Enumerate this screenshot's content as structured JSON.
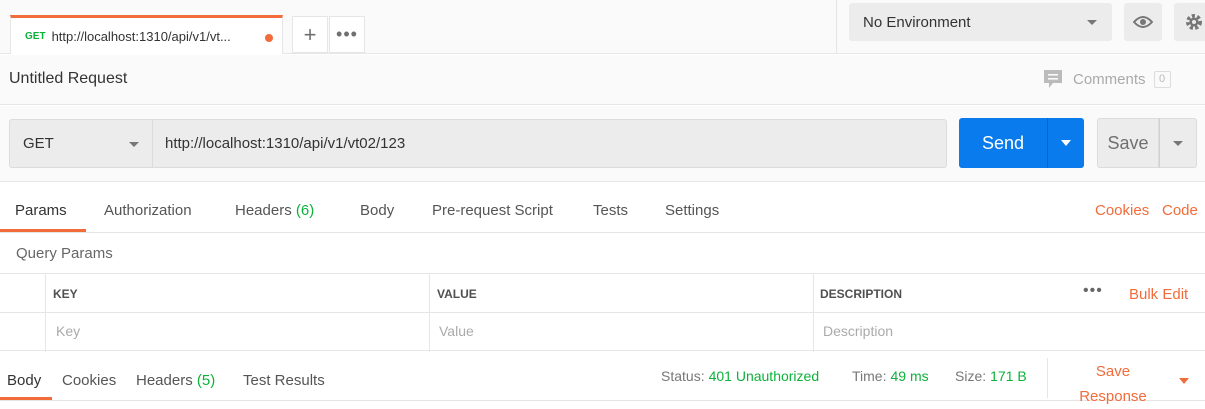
{
  "tabs": [
    {
      "method": "GET",
      "title": "http://localhost:1310/api/v1/vt..."
    }
  ],
  "environment": {
    "selected": "No Environment"
  },
  "request": {
    "title": "Untitled Request",
    "comments_label": "Comments",
    "comments_count": "0",
    "method": "GET",
    "url": "http://localhost:1310/api/v1/vt02/123",
    "send_label": "Send",
    "save_label": "Save"
  },
  "request_tabs": {
    "params": "Params",
    "authorization": "Authorization",
    "headers": "Headers",
    "headers_count": "(6)",
    "body": "Body",
    "prerequest": "Pre-request Script",
    "tests": "Tests",
    "settings": "Settings",
    "cookies": "Cookies",
    "code": "Code"
  },
  "query_params": {
    "label": "Query Params",
    "columns": [
      "KEY",
      "VALUE",
      "DESCRIPTION"
    ],
    "placeholders": [
      "Key",
      "Value",
      "Description"
    ],
    "bulk_edit": "Bulk Edit"
  },
  "response": {
    "tabs": {
      "body": "Body",
      "cookies": "Cookies",
      "headers": "Headers",
      "headers_count": "(5)",
      "test_results": "Test Results"
    },
    "status_label": "Status:",
    "status_value": "401 Unauthorized",
    "time_label": "Time:",
    "time_value": "49 ms",
    "size_label": "Size:",
    "size_value": "171 B",
    "save_response_line1": "Save",
    "save_response_line2": "Response"
  },
  "colors": {
    "accent": "#f26b3a",
    "primary": "#097bed",
    "success": "#0cb23a"
  }
}
